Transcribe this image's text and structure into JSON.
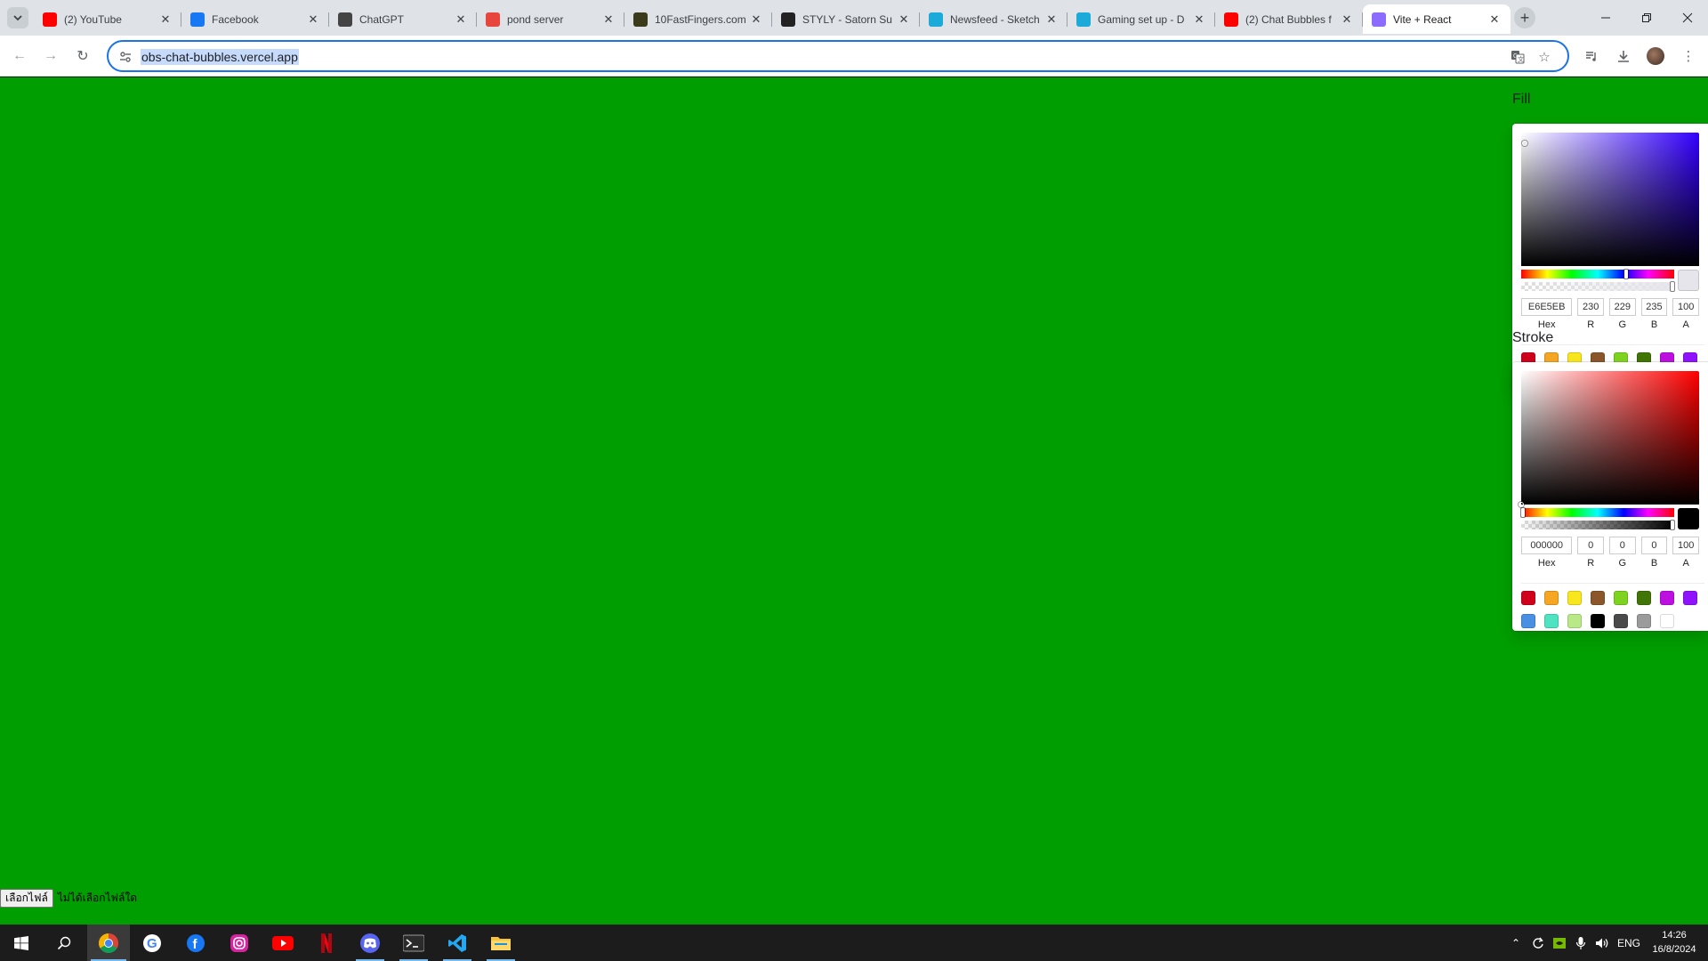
{
  "browser": {
    "tabs": [
      {
        "title": "(2) YouTube",
        "favicon": "youtube-icon",
        "color": "#ff0000",
        "active": false
      },
      {
        "title": "Facebook",
        "favicon": "facebook-icon",
        "color": "#1877f2",
        "active": false
      },
      {
        "title": "ChatGPT",
        "favicon": "chatgpt-icon",
        "color": "#444444",
        "active": false
      },
      {
        "title": "pond server",
        "favicon": "pond-server-icon",
        "color": "#e8453c",
        "active": false
      },
      {
        "title": "10FastFingers.com",
        "favicon": "10fastfingers-icon",
        "color": "#3b3b1b",
        "active": false
      },
      {
        "title": "STYLY - Satorn Su",
        "favicon": "styly-icon",
        "color": "#222222",
        "active": false
      },
      {
        "title": "Newsfeed - Sketch",
        "favicon": "sketchfab-icon",
        "color": "#1caad9",
        "active": false
      },
      {
        "title": "Gaming set up - D",
        "favicon": "sketchfab-icon",
        "color": "#1caad9",
        "active": false
      },
      {
        "title": "(2) Chat Bubbles f",
        "favicon": "youtube-icon",
        "color": "#ff0000",
        "active": false
      },
      {
        "title": "Vite + React",
        "favicon": "vite-icon",
        "color": "#8c6cff",
        "active": true
      }
    ],
    "url": "obs-chat-bubbles.vercel.app"
  },
  "page": {
    "background": "#009e00",
    "fill": {
      "label": "Fill",
      "hue_color": "#3300ff",
      "swatch_color": "#e6e5eb",
      "hex": "E6E5EB",
      "r": "230",
      "g": "229",
      "b": "235",
      "a": "100",
      "hue_position": 0.69,
      "sat_cursor": [
        0.02,
        0.08
      ]
    },
    "stroke": {
      "label": "Stroke",
      "hue_color": "#ff0000",
      "swatch_color": "#000000",
      "hex": "000000",
      "r": "0",
      "g": "0",
      "b": "0",
      "a": "100",
      "hue_position": 0.0,
      "sat_cursor": [
        0.0,
        1.0
      ]
    },
    "field_labels": {
      "hex": "Hex",
      "r": "R",
      "g": "G",
      "b": "B",
      "a": "A"
    },
    "preset_colors": [
      "#d0021b",
      "#f5a623",
      "#f8e71c",
      "#8b572a",
      "#7ed321",
      "#417505",
      "#bd10e0",
      "#9013fe",
      "#4a90e2",
      "#50e3c2",
      "#b8e986",
      "#000000",
      "#4a4a4a",
      "#9b9b9b",
      "#ffffff"
    ],
    "file_button": "เลือกไฟล์",
    "file_status": "ไม่ได้เลือกไฟล์ใด"
  },
  "taskbar": {
    "apps": [
      "start-icon",
      "search-icon",
      "chrome-icon",
      "google-icon",
      "facebook-icon",
      "instagram-icon",
      "youtube-icon",
      "netflix-icon",
      "discord-icon",
      "terminal-icon",
      "vscode-icon",
      "file-explorer-icon"
    ],
    "language": "ENG",
    "time": "14:26",
    "date": "16/8/2024"
  }
}
